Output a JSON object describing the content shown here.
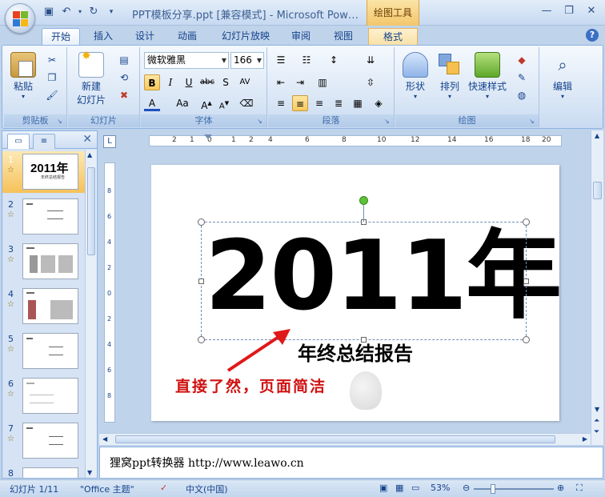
{
  "window": {
    "title": "PPT模板分享.ppt [兼容模式] - Microsoft Pow…",
    "context_tab_header": "绘图工具"
  },
  "tabs": [
    "开始",
    "插入",
    "设计",
    "动画",
    "幻灯片放映",
    "审阅",
    "视图",
    "格式"
  ],
  "ribbon": {
    "clipboard": {
      "label": "剪贴板",
      "paste": "粘贴"
    },
    "slides": {
      "label": "幻灯片",
      "new_slide_line1": "新建",
      "new_slide_line2": "幻灯片"
    },
    "font": {
      "label": "字体",
      "font_name": "微软雅黑",
      "font_size": "166"
    },
    "paragraph": {
      "label": "段落"
    },
    "drawing": {
      "label": "绘图",
      "shapes": "形状",
      "arrange": "排列",
      "quick_styles": "快速样式"
    },
    "editing": {
      "label": "编辑"
    }
  },
  "slides": [
    {
      "num": "1",
      "title": "2011年",
      "subtitle": "年终总结报告"
    },
    {
      "num": "2"
    },
    {
      "num": "3"
    },
    {
      "num": "4"
    },
    {
      "num": "5"
    },
    {
      "num": "6"
    },
    {
      "num": "7"
    },
    {
      "num": "8"
    }
  ],
  "slide": {
    "year": "2011年",
    "subtitle": "年终总结报告",
    "annotation": "直接了然，页面简洁"
  },
  "ruler": {
    "marks": [
      "2",
      "1",
      "0",
      "1",
      "2",
      "4",
      "6",
      "8",
      "10",
      "12",
      "14",
      "16",
      "18",
      "20"
    ],
    "v_marks": [
      "8",
      "6",
      "4",
      "2",
      "0",
      "2",
      "4",
      "6",
      "8",
      "10",
      "12"
    ]
  },
  "notes": {
    "text": "狸窝ppt转换器  http://www.leawo.cn"
  },
  "status": {
    "slide_info": "幻灯片 1/11",
    "theme": "\"Office 主题\"",
    "language": "中文(中国)",
    "zoom": "53%",
    "zoom_fraction": 0.53
  },
  "colors": {
    "accent": "#15428b",
    "annotation": "#d01010",
    "selected_thumb": "#f6c15a"
  }
}
